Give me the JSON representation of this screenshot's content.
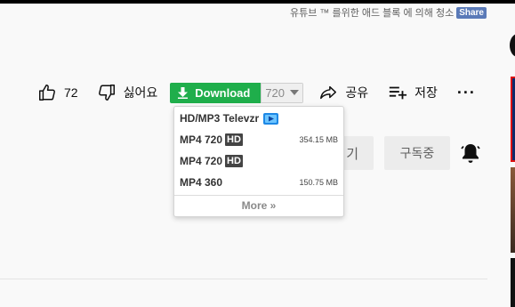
{
  "ad_notice": {
    "text": "유튜브 ™ 를위한 애드 블록 에 의해 청소",
    "share_label": "Share"
  },
  "actions": {
    "like_count": "72",
    "dislike_label": "싫어요",
    "download_label": "Download",
    "quality_value": "720",
    "share_label": "공유",
    "save_label": "저장",
    "more_label": "···"
  },
  "channel": {
    "join_label": "기",
    "subscribed_label": "구독중"
  },
  "download_menu": {
    "items": [
      {
        "label": "HD/MP3 Televzr",
        "size": "",
        "hd": ""
      },
      {
        "label": "MP4 720",
        "size": "354.15 MB",
        "hd": "HD"
      },
      {
        "label": "MP4 720",
        "size": "",
        "hd": "HD"
      },
      {
        "label": "MP4 360",
        "size": "150.75 MB",
        "hd": ""
      }
    ],
    "more_label": "More »"
  },
  "colors": {
    "download_green": "#1fae4b",
    "share_badge": "#5a7ab8",
    "televzr_blue": "#1e88e5"
  },
  "icons": [
    "thumbs-up-icon",
    "thumbs-down-icon",
    "download-arrow-icon",
    "caret-down-icon",
    "share-arrow-icon",
    "add-to-playlist-icon",
    "more-icon",
    "bell-icon",
    "televzr-icon"
  ]
}
